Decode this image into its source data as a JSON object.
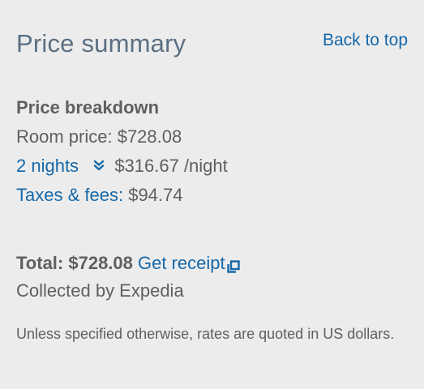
{
  "header": {
    "title": "Price summary",
    "back_to_top": "Back to top"
  },
  "breakdown": {
    "title": "Price breakdown",
    "room_price": "Room price: $728.08",
    "nights_link": "2 nights",
    "nightly_rate": "$316.67 /night",
    "taxes_link": "Taxes & fees:",
    "taxes_amount": "$94.74"
  },
  "total": {
    "label": "Total: $728.08",
    "receipt_link": "Get receipt",
    "collected_by": "Collected by Expedia"
  },
  "disclaimer": "Unless specified otherwise, rates are quoted in US dollars.",
  "colors": {
    "link": "#1668a8",
    "title": "#5b6f82",
    "text": "#5f5f5f",
    "background": "#ececec"
  },
  "icons": {
    "nights_toggle": "chevron-double-down-icon",
    "receipt": "external-link-icon"
  }
}
